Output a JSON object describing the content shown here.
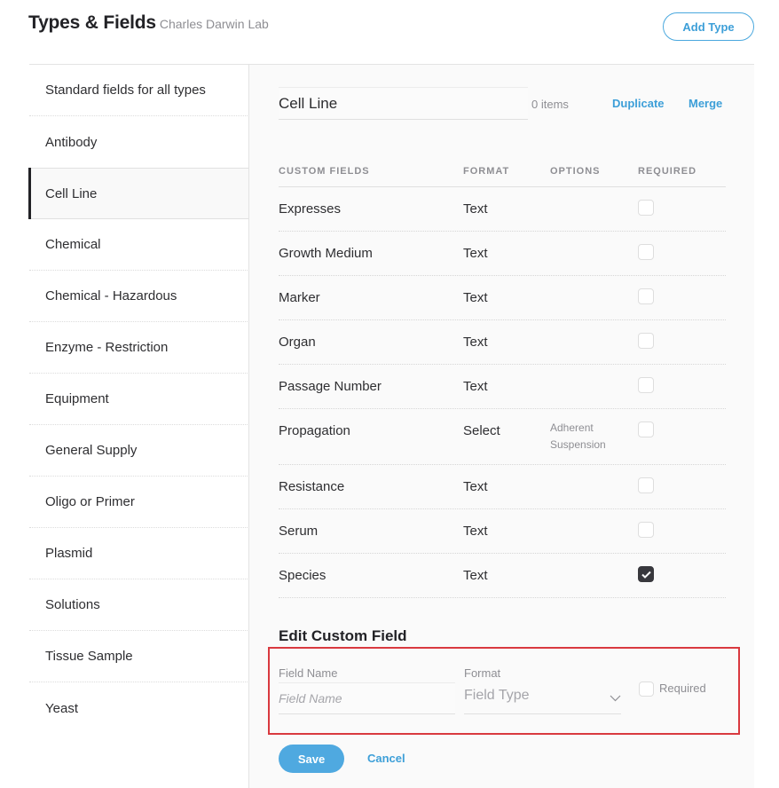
{
  "header": {
    "title": "Types & Fields",
    "subtitle": "Charles Darwin Lab",
    "add_type_label": "Add Type"
  },
  "sidebar": {
    "active_index": 2,
    "items": [
      {
        "label": "Standard fields for all types"
      },
      {
        "label": "Antibody"
      },
      {
        "label": "Cell Line"
      },
      {
        "label": "Chemical"
      },
      {
        "label": "Chemical - Hazardous"
      },
      {
        "label": "Enzyme - Restriction"
      },
      {
        "label": "Equipment"
      },
      {
        "label": "General Supply"
      },
      {
        "label": "Oligo or Primer"
      },
      {
        "label": "Plasmid"
      },
      {
        "label": "Solutions"
      },
      {
        "label": "Tissue Sample"
      },
      {
        "label": "Yeast"
      }
    ]
  },
  "type_detail": {
    "name_value": "Cell Line",
    "items_count": "0 items",
    "duplicate_label": "Duplicate",
    "merge_label": "Merge"
  },
  "fields_table": {
    "headers": {
      "name": "CUSTOM FIELDS",
      "format": "FORMAT",
      "options": "OPTIONS",
      "required": "REQUIRED"
    },
    "rows": [
      {
        "name": "Expresses",
        "format": "Text",
        "options": [],
        "required": false
      },
      {
        "name": "Growth Medium",
        "format": "Text",
        "options": [],
        "required": false
      },
      {
        "name": "Marker",
        "format": "Text",
        "options": [],
        "required": false
      },
      {
        "name": "Organ",
        "format": "Text",
        "options": [],
        "required": false
      },
      {
        "name": "Passage Number",
        "format": "Text",
        "options": [],
        "required": false
      },
      {
        "name": "Propagation",
        "format": "Select",
        "options": [
          "Adherent",
          "Suspension"
        ],
        "required": false
      },
      {
        "name": "Resistance",
        "format": "Text",
        "options": [],
        "required": false
      },
      {
        "name": "Serum",
        "format": "Text",
        "options": [],
        "required": false
      },
      {
        "name": "Species",
        "format": "Text",
        "options": [],
        "required": true
      }
    ]
  },
  "edit_field": {
    "title": "Edit Custom Field",
    "field_name_label": "Field Name",
    "field_name_value": "",
    "field_name_placeholder": "Field Name",
    "format_label": "Format",
    "format_placeholder": "Field Type",
    "required_label": "Required",
    "required": false,
    "save_label": "Save",
    "cancel_label": "Cancel"
  },
  "colors": {
    "accent": "#3d9fd8",
    "highlight_border": "#d9393f",
    "checked": "#38383d"
  }
}
